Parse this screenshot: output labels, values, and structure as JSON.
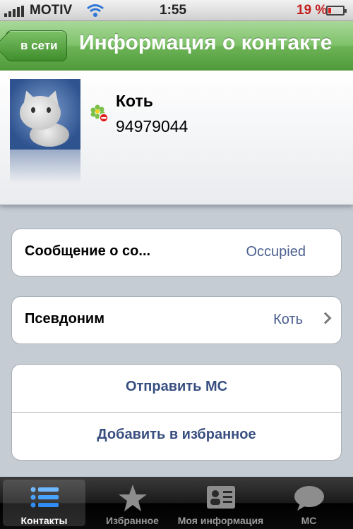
{
  "status_bar": {
    "carrier": "MOTIV",
    "time": "1:55",
    "battery": "19 %",
    "battery_level": 0.19
  },
  "nav": {
    "back_label": "в сети",
    "title": "Информация о контакте"
  },
  "contact": {
    "name": "Коть",
    "uin": "94979044",
    "status_icon": "icq-flower-busy-icon"
  },
  "rows": {
    "message": {
      "label": "Сообщение о со...",
      "value": "Occupied"
    },
    "nickname": {
      "label": "Псевдоним",
      "value": "Коть"
    }
  },
  "actions": {
    "send_sms": "Отправить МС",
    "add_favorites": "Добавить в избранное"
  },
  "tabs": [
    {
      "label": "Контакты",
      "icon": "list-icon",
      "active": true
    },
    {
      "label": "Избранное",
      "icon": "star-icon",
      "active": false
    },
    {
      "label": "Моя информация",
      "icon": "contact-card-icon",
      "active": false
    },
    {
      "label": "МС",
      "icon": "speech-bubble-icon",
      "active": false
    }
  ],
  "colors": {
    "nav_green": "#6cb356",
    "link_blue": "#384f80",
    "value_blue": "#4a5f8f",
    "battery_red": "#d22222"
  }
}
